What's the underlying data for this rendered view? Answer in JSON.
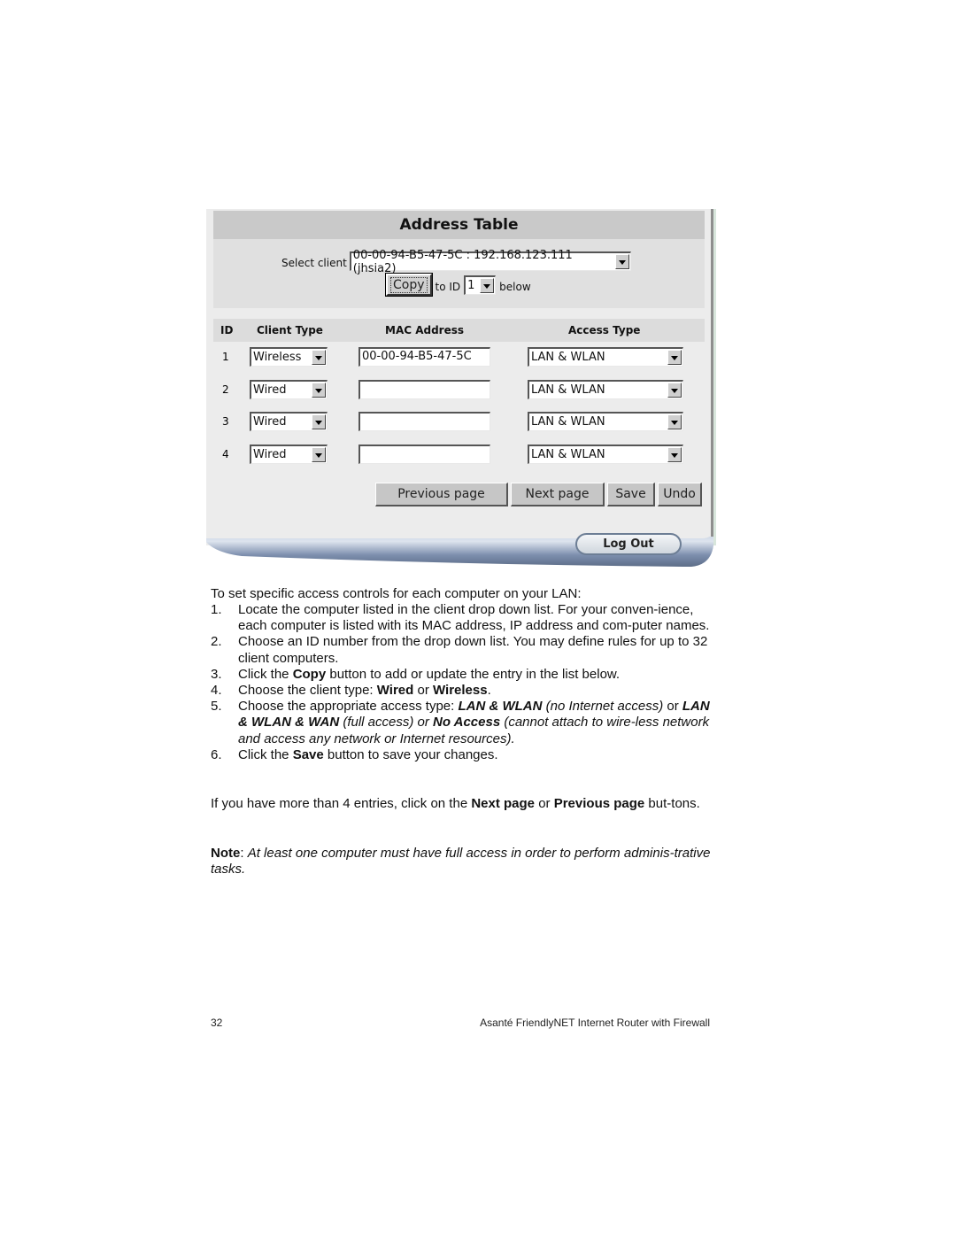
{
  "screenshot": {
    "title": "Address Table",
    "select_client": {
      "label": "Select client",
      "value": "00-00-94-B5-47-5C : 192.168.123.111 (jhsia2)"
    },
    "copy_button": "Copy",
    "to_id_label": "to ID",
    "to_id_value": "1",
    "below_label": "below",
    "table": {
      "headers": [
        "ID",
        "Client Type",
        "MAC Address",
        "Access Type"
      ],
      "rows": [
        {
          "id": "1",
          "client_type": "Wireless",
          "mac": "00-00-94-B5-47-5C",
          "access_type": "LAN & WLAN"
        },
        {
          "id": "2",
          "client_type": "Wired",
          "mac": "",
          "access_type": "LAN & WLAN"
        },
        {
          "id": "3",
          "client_type": "Wired",
          "mac": "",
          "access_type": "LAN & WLAN"
        },
        {
          "id": "4",
          "client_type": "Wired",
          "mac": "",
          "access_type": "LAN & WLAN"
        }
      ]
    },
    "buttons": {
      "previous": "Previous page",
      "next": "Next page",
      "save": "Save",
      "undo": "Undo"
    },
    "logout": "Log Out"
  },
  "document": {
    "intro": "To set specific access controls for each computer on your LAN:",
    "steps": [
      {
        "num": "1.",
        "parts": [
          {
            "t": "Locate the computer listed in the client drop down list. For your conven-ience, each computer is listed with its MAC address, IP address and com-puter names."
          }
        ]
      },
      {
        "num": "2.",
        "parts": [
          {
            "t": "Choose an ID number from the drop down list. You may define rules for up to 32 client computers."
          }
        ]
      },
      {
        "num": "3.",
        "parts": [
          {
            "t": "Click the "
          },
          {
            "t": "Copy",
            "b": true
          },
          {
            "t": " button to add or update the entry in the list below."
          }
        ]
      },
      {
        "num": "4.",
        "parts": [
          {
            "t": "Choose the client type: "
          },
          {
            "t": "Wired",
            "b": true
          },
          {
            "t": " or "
          },
          {
            "t": "Wireless",
            "b": true
          },
          {
            "t": "."
          }
        ]
      },
      {
        "num": "5.",
        "parts": [
          {
            "t": "Choose the appropriate access type: "
          },
          {
            "t": "LAN & WLAN",
            "b": true,
            "i": true
          },
          {
            "t": " (no Internet access)",
            "i": true
          },
          {
            "t": " or "
          },
          {
            "t": "LAN & WLAN & WAN",
            "b": true,
            "i": true
          },
          {
            "t": " (full access) or ",
            "i": true
          },
          {
            "t": "No Access",
            "b": true,
            "i": true
          },
          {
            "t": " (cannot attach to wire-less network and access any network or Internet resources).",
            "i": true
          }
        ]
      },
      {
        "num": "6.",
        "parts": [
          {
            "t": "Click the "
          },
          {
            "t": "Save",
            "b": true
          },
          {
            "t": " button to save your changes."
          }
        ]
      }
    ],
    "para2": [
      {
        "t": "If you have more than 4 entries, click on the "
      },
      {
        "t": "Next page",
        "b": true
      },
      {
        "t": " or "
      },
      {
        "t": "Previous page",
        "b": true
      },
      {
        "t": " but-tons."
      }
    ],
    "note": [
      {
        "t": "Note",
        "b": true
      },
      {
        "t": ": "
      },
      {
        "t": "At least one computer must have full access in order to perform adminis-trative tasks.",
        "i": true
      }
    ]
  },
  "footer": {
    "page_number": "32",
    "book_title": "Asanté FriendlyNET Internet  Router with Firewall"
  }
}
